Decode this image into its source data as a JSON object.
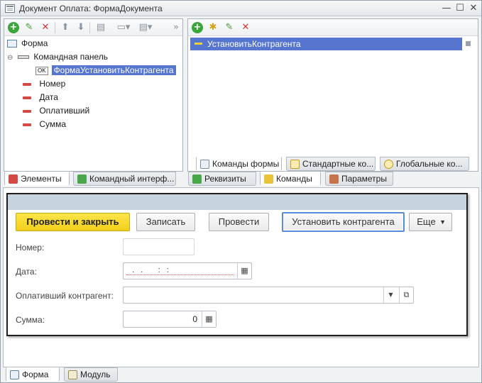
{
  "window": {
    "title": "Документ Оплата: ФормаДокумента",
    "min": "—",
    "max": "☐",
    "close": "✕"
  },
  "elements_tree": {
    "root": "Форма",
    "cmd_panel": "Командная панель",
    "cmd_item": "ФормаУстановитьКонтрагента",
    "fields": [
      "Номер",
      "Дата",
      "Оплативший",
      "Сумма"
    ],
    "ok_badge": "OK"
  },
  "left_tabs": [
    "Элементы",
    "Командный интерф..."
  ],
  "commands_list": {
    "selected": "УстановитьКонтрагента"
  },
  "command_subtabs": [
    "Команды формы",
    "Стандартные ко...",
    "Глобальные ко..."
  ],
  "right_tabs": [
    "Реквизиты",
    "Команды",
    "Параметры"
  ],
  "preview": {
    "buttons": {
      "post_close": "Провести и закрыть",
      "save": "Записать",
      "post": "Провести",
      "set_contractor": "Установить контрагента",
      "more": "Еще"
    },
    "labels": {
      "number": "Номер:",
      "date": "Дата:",
      "payer": "Оплативший контрагент:",
      "sum": "Сумма:"
    },
    "values": {
      "number": "",
      "date": "  .  .     :  :  ",
      "payer": "",
      "sum": "0"
    }
  },
  "bottom_tabs": [
    "Форма",
    "Модуль"
  ],
  "icons": [
    "add-icon",
    "edit-icon",
    "delete-icon",
    "move-up-icon",
    "move-down-icon",
    "calendar-icon",
    "dropdown-icon",
    "open-icon"
  ],
  "colors": {
    "selection": "#5675cf",
    "primary_button": "#f5d52a",
    "accent_red": "#d24a43"
  }
}
